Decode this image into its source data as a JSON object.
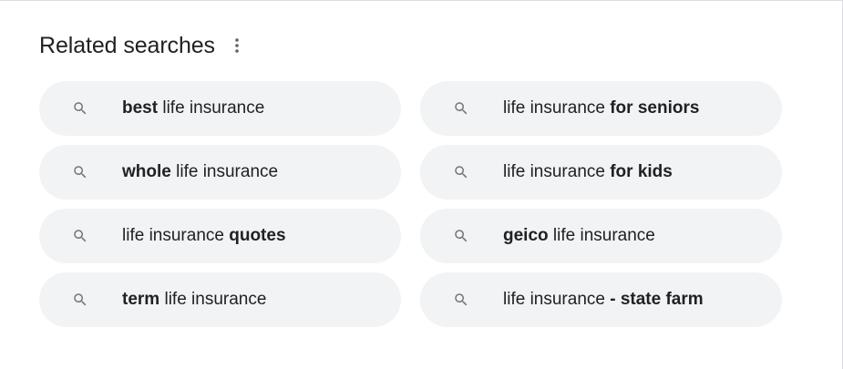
{
  "section": {
    "title": "Related searches",
    "more_icon": "more-vert-icon"
  },
  "search_icon": "search-icon",
  "colors": {
    "chip_background": "#f1f3f4",
    "text": "#202124",
    "icon": "#70757a"
  },
  "items": [
    {
      "parts": [
        {
          "text": "best",
          "bold": true
        },
        {
          "text": " life insurance",
          "bold": false
        }
      ]
    },
    {
      "parts": [
        {
          "text": "life insurance ",
          "bold": false
        },
        {
          "text": "for seniors",
          "bold": true
        }
      ]
    },
    {
      "parts": [
        {
          "text": "whole",
          "bold": true
        },
        {
          "text": " life insurance",
          "bold": false
        }
      ]
    },
    {
      "parts": [
        {
          "text": "life insurance ",
          "bold": false
        },
        {
          "text": "for kids",
          "bold": true
        }
      ]
    },
    {
      "parts": [
        {
          "text": "life insurance ",
          "bold": false
        },
        {
          "text": "quotes",
          "bold": true
        }
      ]
    },
    {
      "parts": [
        {
          "text": "geico",
          "bold": true
        },
        {
          "text": " life insurance",
          "bold": false
        }
      ]
    },
    {
      "parts": [
        {
          "text": "term",
          "bold": true
        },
        {
          "text": " life insurance",
          "bold": false
        }
      ]
    },
    {
      "parts": [
        {
          "text": "life insurance ",
          "bold": false
        },
        {
          "text": "- state farm",
          "bold": true
        }
      ]
    }
  ]
}
